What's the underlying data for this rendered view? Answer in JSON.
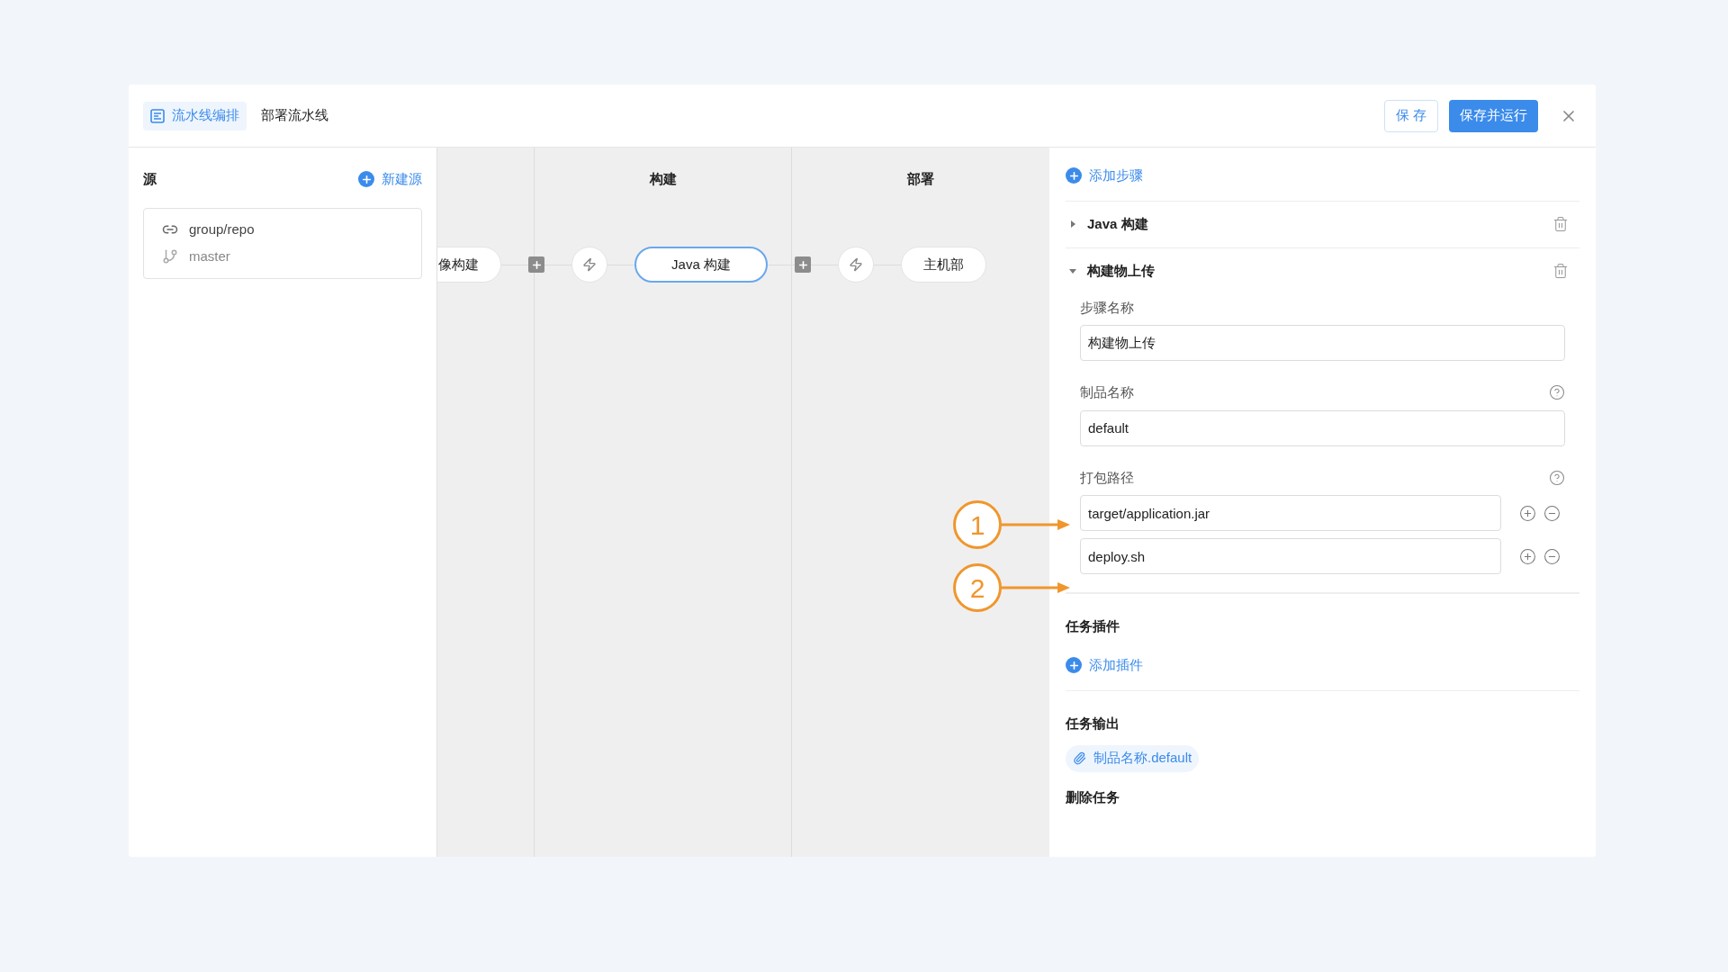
{
  "header": {
    "tabs": [
      {
        "label": "流水线编排",
        "selected": true
      },
      {
        "label": "部署流水线",
        "selected": false
      }
    ],
    "save_button": "保 存",
    "save_run_button": "保存并运行"
  },
  "source": {
    "title": "源",
    "new_button": "新建源",
    "repo": "group/repo",
    "branch": "master"
  },
  "canvas": {
    "stages": [
      {
        "title": "构建"
      },
      {
        "title": "部署"
      }
    ],
    "nodes": [
      {
        "kind": "job",
        "label": "像构建",
        "selected": false
      },
      {
        "kind": "add"
      },
      {
        "kind": "trigger"
      },
      {
        "kind": "job",
        "label": "Java 构建",
        "selected": true
      },
      {
        "kind": "add"
      },
      {
        "kind": "trigger"
      },
      {
        "kind": "job",
        "label": "主机部",
        "selected": false
      }
    ]
  },
  "editor": {
    "add_step": "添加步骤",
    "steps": [
      {
        "title": "Java 构建",
        "expanded": false
      },
      {
        "title": "构建物上传",
        "expanded": true
      }
    ],
    "step_name": {
      "label": "步骤名称",
      "value": "构建物上传"
    },
    "artifact_name": {
      "label": "制品名称",
      "value": "default"
    },
    "package_paths": {
      "label": "打包路径",
      "values": [
        "target/application.jar",
        "deploy.sh"
      ]
    },
    "plugins": {
      "title": "任务插件",
      "add": "添加插件"
    },
    "output": {
      "title": "任务输出",
      "tag": "制品名称.default"
    },
    "delete_title": "删除任务"
  },
  "annotations": [
    {
      "label": "1"
    },
    {
      "label": "2"
    }
  ]
}
